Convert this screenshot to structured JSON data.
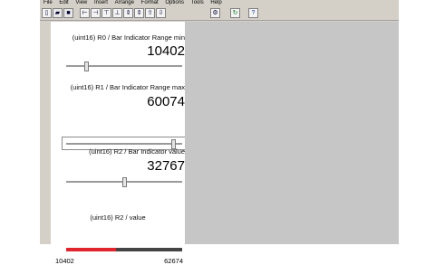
{
  "menu": [
    "File",
    "Edit",
    "View",
    "Insert",
    "Arrange",
    "Format",
    "Options",
    "Tools",
    "Help"
  ],
  "toolbar_icons": [
    "new-file-icon",
    "open-folder-icon",
    "save-icon",
    "align-left-icon",
    "align-right-icon",
    "align-top-icon",
    "align-bottom-icon",
    "distribute-h-icon",
    "distribute-v-icon",
    "bring-front-icon",
    "send-back-icon",
    "settings-icon",
    "refresh-icon",
    "help-icon"
  ],
  "widgets": {
    "r0": {
      "label": "(uint16) R0 / Bar Indicator Range min",
      "value": "10402",
      "slider_fraction": 0.17
    },
    "r1": {
      "label": "(uint16) R1 /  Bar Indicator Range max",
      "value": "60074",
      "slider_fraction": 0.92
    },
    "r2": {
      "label": "(uint16) R2 /  Bar Indicator value",
      "value": "32767",
      "slider_fraction": 0.5
    },
    "bar": {
      "label": "(uint16) R2 / value",
      "min": "10402",
      "max": "62674",
      "fill_fraction": 0.43,
      "fill_color": "#e0262c"
    }
  }
}
